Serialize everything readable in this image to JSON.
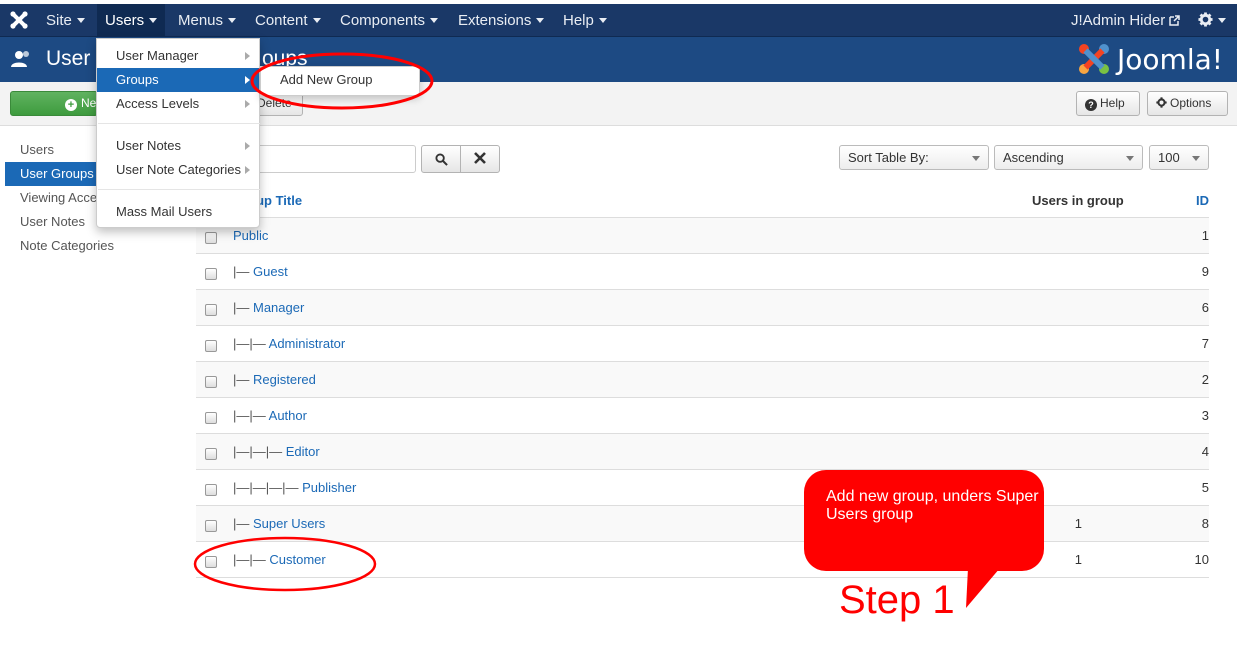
{
  "topnav": {
    "items": [
      {
        "label": "Site"
      },
      {
        "label": "Users"
      },
      {
        "label": "Menus"
      },
      {
        "label": "Content"
      },
      {
        "label": "Components"
      },
      {
        "label": "Extensions"
      },
      {
        "label": "Help"
      }
    ],
    "user_label": "J!Admin Hider",
    "icons": {
      "logo": "joomla-icon",
      "external": "external-link-icon",
      "settings": "gear-icon"
    }
  },
  "header": {
    "title_part1": "User",
    "title_part2": "oups",
    "brand": "Joomla!",
    "colors": {
      "nav": "#1a3867",
      "header": "#1d4a83",
      "accent": "#1b69b6"
    }
  },
  "toolbar": {
    "new_label": "Ne",
    "delete_label": "Delete",
    "help_label": "Help",
    "options_label": "Options"
  },
  "sidebar": {
    "items": [
      {
        "label": "Users"
      },
      {
        "label": "User Groups"
      },
      {
        "label": "Viewing Access Levels"
      },
      {
        "label": "User Notes"
      },
      {
        "label": "Note Categories"
      }
    ]
  },
  "filters": {
    "search_value": "",
    "sort_label": "Sort Table By:",
    "direction": "Ascending",
    "limit": "100"
  },
  "table": {
    "headers": {
      "title": "Group Title",
      "users": "Users in group",
      "id": "ID"
    },
    "rows": [
      {
        "prefix": "",
        "title": "Public",
        "users": "",
        "id": "1"
      },
      {
        "prefix": "|— ",
        "title": "Guest",
        "users": "",
        "id": "9"
      },
      {
        "prefix": "|— ",
        "title": "Manager",
        "users": "",
        "id": "6"
      },
      {
        "prefix": "|—|— ",
        "title": "Administrator",
        "users": "",
        "id": "7"
      },
      {
        "prefix": "|— ",
        "title": "Registered",
        "users": "",
        "id": "2"
      },
      {
        "prefix": "|—|— ",
        "title": "Author",
        "users": "",
        "id": "3"
      },
      {
        "prefix": "|—|—|— ",
        "title": "Editor",
        "users": "",
        "id": "4"
      },
      {
        "prefix": "|—|—|—|— ",
        "title": "Publisher",
        "users": "",
        "id": "5"
      },
      {
        "prefix": "|— ",
        "title": "Super Users",
        "users": "1",
        "id": "8"
      },
      {
        "prefix": "|—|— ",
        "title": "Customer",
        "users": "1",
        "id": "10"
      }
    ]
  },
  "dropdown": {
    "items": [
      {
        "label": "User Manager"
      },
      {
        "label": "Groups"
      },
      {
        "label": "Access Levels"
      },
      {
        "label": "User Notes"
      },
      {
        "label": "User Note Categories"
      },
      {
        "label": "Mass Mail Users"
      }
    ],
    "submenu_label": "Add New Group"
  },
  "annotation": {
    "callout_text": "Add new group, unders Super Users group",
    "step_label": "Step 1",
    "color": "#ff0000"
  }
}
